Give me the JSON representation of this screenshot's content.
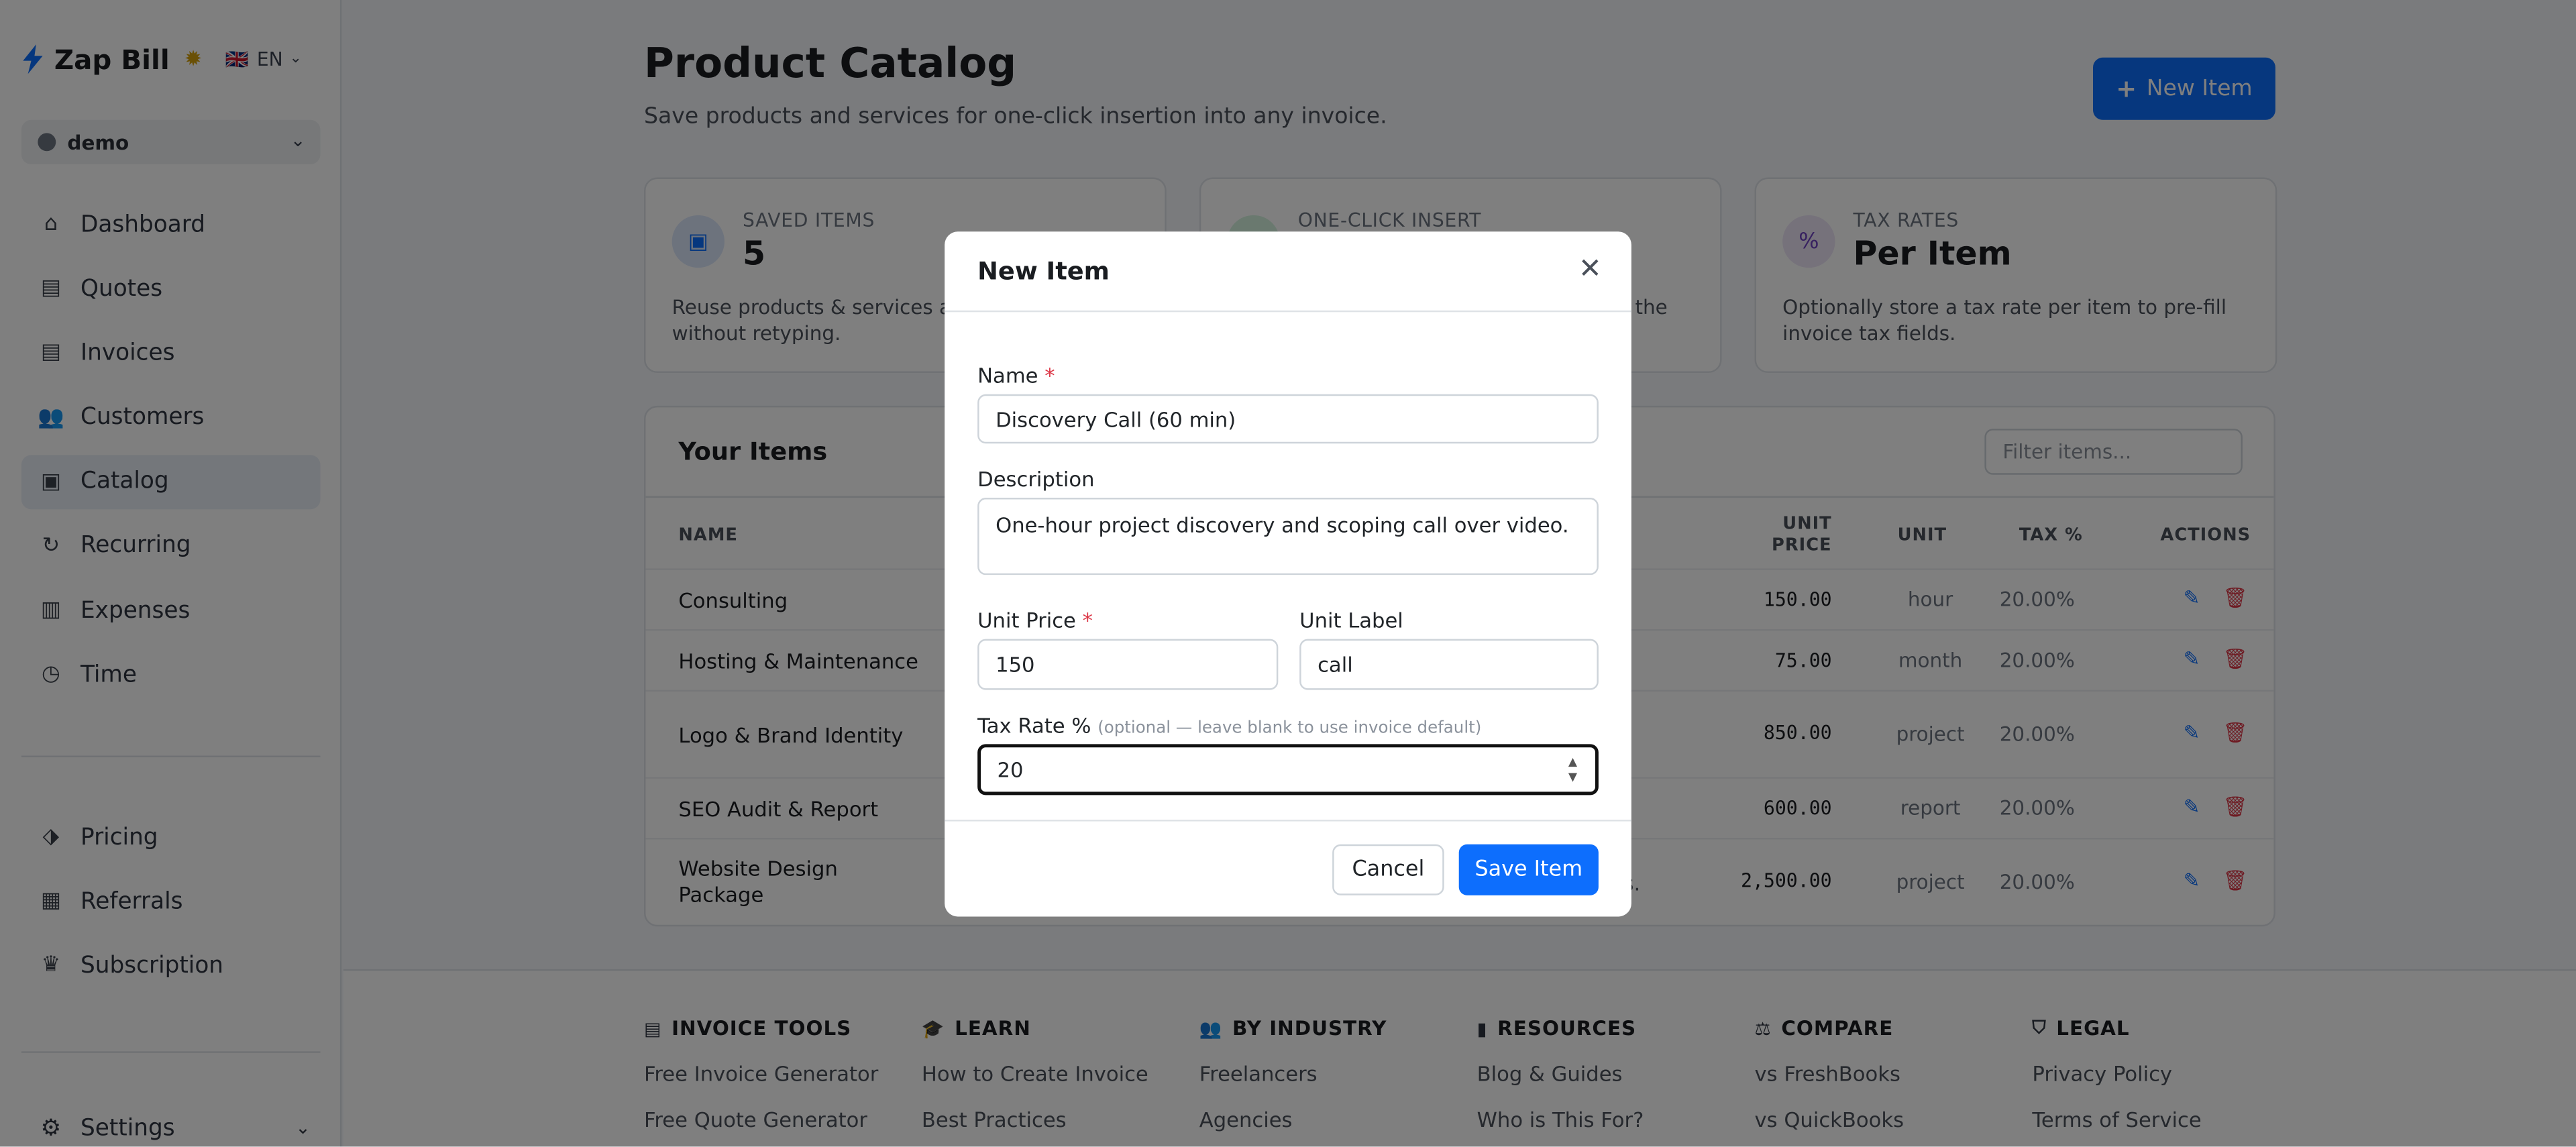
{
  "brand": {
    "name": "Zap Bill",
    "lang": "EN",
    "flag": "🇬🇧"
  },
  "org": {
    "name": "demo"
  },
  "nav": [
    {
      "label": "Dashboard",
      "icon": "home-icon"
    },
    {
      "label": "Quotes",
      "icon": "file-icon"
    },
    {
      "label": "Invoices",
      "icon": "file-invoice-icon"
    },
    {
      "label": "Customers",
      "icon": "users-icon"
    },
    {
      "label": "Catalog",
      "icon": "box-icon",
      "active": true
    },
    {
      "label": "Recurring",
      "icon": "repeat-icon"
    },
    {
      "label": "Expenses",
      "icon": "receipt-icon"
    },
    {
      "label": "Time",
      "icon": "clock-icon"
    }
  ],
  "nav2": [
    {
      "label": "Pricing",
      "icon": "tags-icon"
    },
    {
      "label": "Referrals",
      "icon": "gift-icon"
    },
    {
      "label": "Subscription",
      "icon": "crown-icon"
    }
  ],
  "settings_label": "Settings",
  "page": {
    "title": "Product Catalog",
    "subtitle": "Save products and services for one-click insertion into any invoice.",
    "new_button": "New Item"
  },
  "stats": [
    {
      "label": "SAVED ITEMS",
      "value": "5",
      "desc": "Reuse products & services across invoices without retyping.",
      "color": "#dbe7fb",
      "icon_color": "#0d6efd"
    },
    {
      "label": "ONE-CLICK INSERT",
      "value": "",
      "desc": "the",
      "color": "#d4f3df",
      "icon_color": "#198754"
    },
    {
      "label": "TAX RATES",
      "value": "Per Item",
      "desc": "Optionally store a tax rate per item to pre-fill invoice tax fields.",
      "color": "#ece4f7",
      "icon_color": "#6f42c1"
    }
  ],
  "items": {
    "title": "Your Items",
    "filter_placeholder": "Filter items...",
    "headers": {
      "name": "NAME",
      "unit_price": "UNIT PRICE",
      "unit": "UNIT",
      "tax": "TAX %",
      "actions": "ACTIONS"
    },
    "rows": [
      {
        "name": "Consulting",
        "price": "150.00",
        "unit": "hour",
        "tax": "20.00%"
      },
      {
        "name": "Hosting & Maintenance",
        "price": "75.00",
        "unit": "month",
        "tax": "20.00%"
      },
      {
        "name": "Logo & Brand Identity",
        "price": "850.00",
        "unit": "project",
        "tax": "20.00%"
      },
      {
        "name": "SEO Audit & Report",
        "price": "600.00",
        "unit": "report",
        "tax": "20.00%"
      },
      {
        "name": "Website Design Package",
        "price": "2,500.00",
        "unit": "project",
        "tax": "20.00%",
        "desc_fragment": "s."
      }
    ]
  },
  "footer": [
    {
      "heading": "INVOICE TOOLS",
      "icon": "file-icon",
      "links": [
        "Free Invoice Generator",
        "Free Quote Generator"
      ]
    },
    {
      "heading": "LEARN",
      "icon": "graduation-cap-icon",
      "links": [
        "How to Create Invoice",
        "Best Practices"
      ]
    },
    {
      "heading": "BY INDUSTRY",
      "icon": "users-icon",
      "links": [
        "Freelancers",
        "Agencies"
      ]
    },
    {
      "heading": "RESOURCES",
      "icon": "book-icon",
      "links": [
        "Blog & Guides",
        "Who is This For?"
      ]
    },
    {
      "heading": "COMPARE",
      "icon": "scale-icon",
      "links": [
        "vs FreshBooks",
        "vs QuickBooks"
      ]
    },
    {
      "heading": "LEGAL",
      "icon": "shield-icon",
      "links": [
        "Privacy Policy",
        "Terms of Service"
      ]
    }
  ],
  "modal": {
    "title": "New Item",
    "name_label": "Name",
    "name_value": "Discovery Call (60 min)",
    "desc_label": "Description",
    "desc_value": "One-hour project discovery and scoping call over video.",
    "price_label": "Unit Price",
    "price_value": "150",
    "unit_label": "Unit Label",
    "unit_value": "call",
    "tax_label": "Tax Rate %",
    "tax_hint": "(optional — leave blank to use invoice default)",
    "tax_value": "20",
    "cancel": "Cancel",
    "save": "Save Item",
    "required_mark": "*"
  }
}
